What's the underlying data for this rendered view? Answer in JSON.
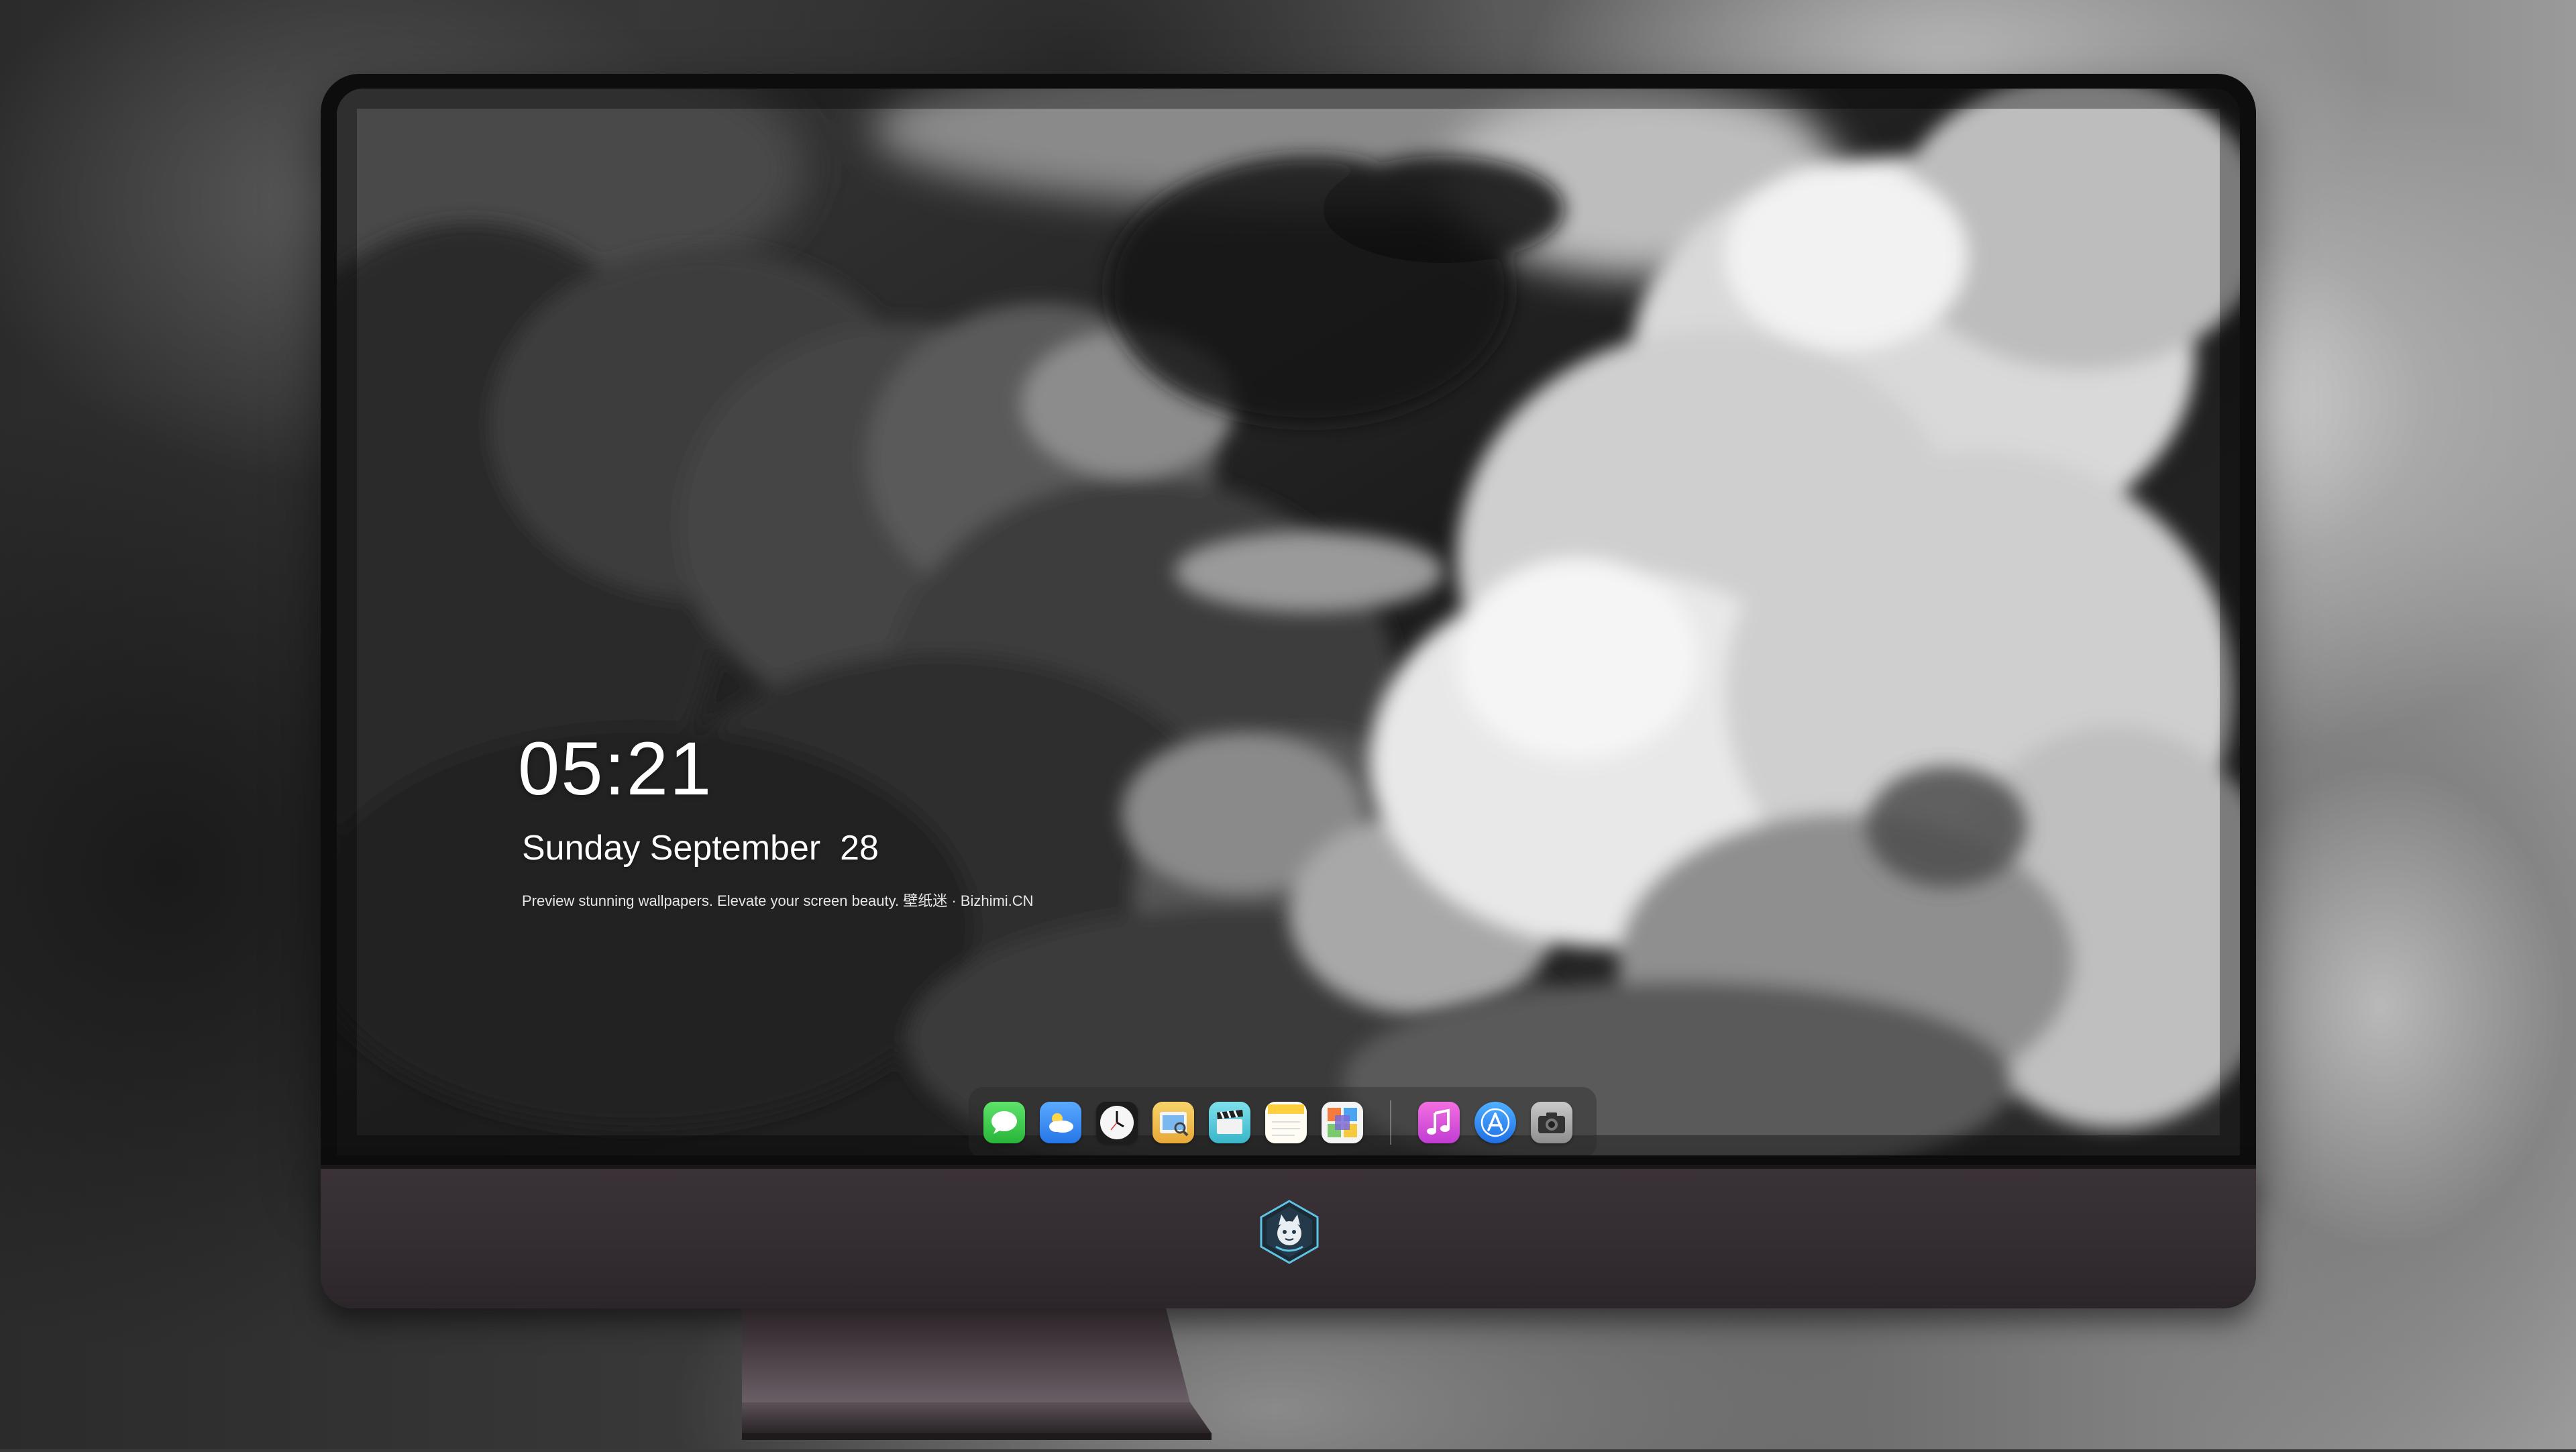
{
  "lock_screen": {
    "time": "05:21",
    "date": "Sunday September  28",
    "tagline": "Preview stunning wallpapers. Elevate your screen beauty. 壁纸迷 · Bizhimi.CN"
  },
  "dock": {
    "apps": [
      {
        "name": "Messages",
        "icon": "messages-icon",
        "color": "#3ec94a"
      },
      {
        "name": "Weather",
        "icon": "weather-icon",
        "color": "#3a8ef6"
      },
      {
        "name": "Clock",
        "icon": "clock-icon",
        "color": "#f4f4f4"
      },
      {
        "name": "Preview",
        "icon": "preview-icon",
        "color": "#f2c14b"
      },
      {
        "name": "Video",
        "icon": "clapperboard-icon",
        "color": "#5ac8d8"
      },
      {
        "name": "Notes",
        "icon": "notes-icon",
        "color": "#ffd84a"
      },
      {
        "name": "Photo Booth",
        "icon": "photo-grid-icon",
        "color": "#7bc96f"
      },
      {
        "name": "Music",
        "icon": "music-icon",
        "color": "#e54fd5"
      },
      {
        "name": "App Store",
        "icon": "app-store-icon",
        "color": "#2f8cf5"
      },
      {
        "name": "Camera",
        "icon": "camera-icon",
        "color": "#9a9a9a"
      }
    ]
  },
  "hardware": {
    "logo": "mascot-logo-icon",
    "bezel_color": "#0d0d0d",
    "chin_color": "#3a3237"
  }
}
